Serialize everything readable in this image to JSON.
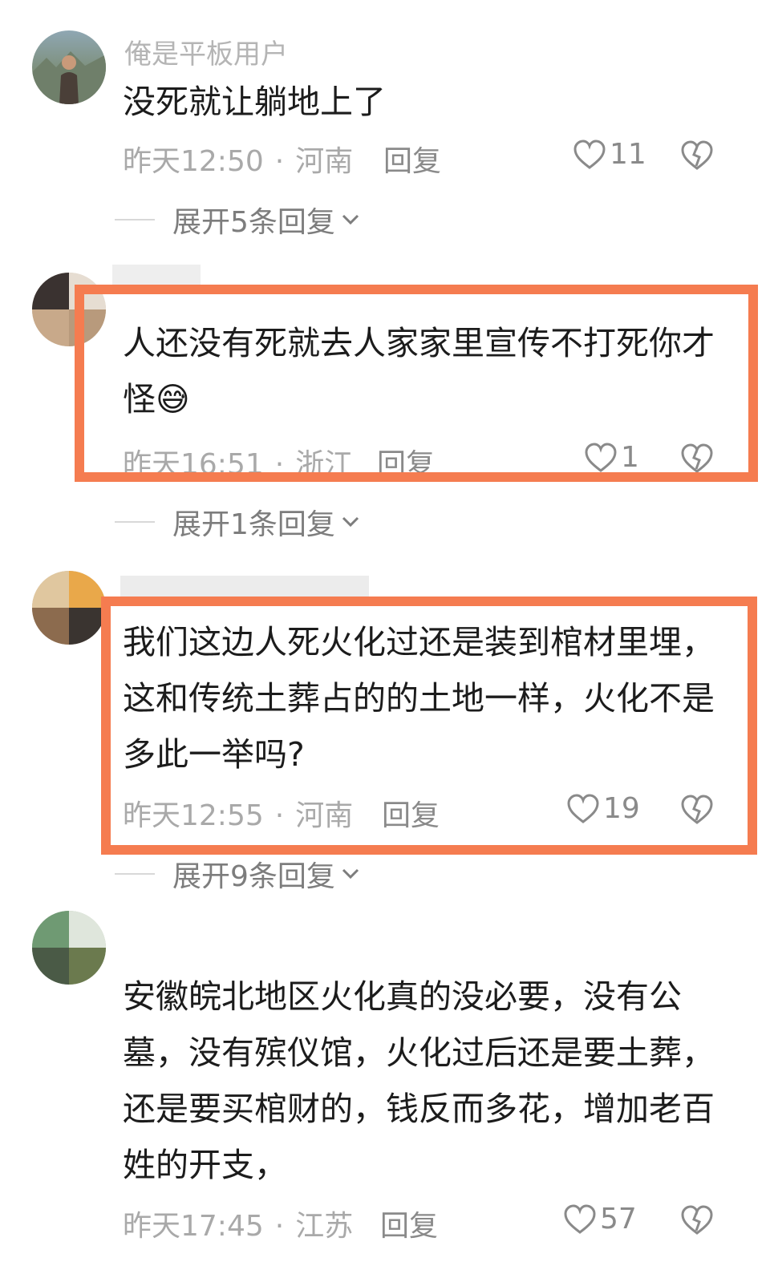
{
  "comments": [
    {
      "username": "俺是平板用户",
      "text": "没死就让躺地上了",
      "time": "昨天12:50",
      "region": "河南",
      "reply_label": "回复",
      "likes": "11",
      "expand_label": "展开5条回复"
    },
    {
      "username": "",
      "text": "人还没有死就去人家家里宣传不打死你才怪😅",
      "time": "昨天16:51",
      "region": "浙江",
      "reply_label": "回复",
      "likes": "1",
      "expand_label": "展开1条回复"
    },
    {
      "username": "",
      "text": "我们这边人死火化过还是装到棺材里埋，这和传统土葬占的的土地一样，火化不是多此一举吗?",
      "time": "昨天12:55",
      "region": "河南",
      "reply_label": "回复",
      "likes": "19",
      "expand_label": "展开9条回复"
    },
    {
      "username": "",
      "text": "安徽皖北地区火化真的没必要，没有公墓，没有殡仪馆，火化过后还是要土葬，还是要买棺财的，钱反而多花，增加老百姓的开支，",
      "time": "昨天17:45",
      "region": "江苏",
      "reply_label": "回复",
      "likes": "57"
    }
  ],
  "separator": "·",
  "colors": {
    "highlight": "#f57c50",
    "text": "#1c1c1c",
    "meta": "#a9a9a9"
  },
  "icons": [
    "heart-outline-icon",
    "broken-heart-icon",
    "chevron-down-icon"
  ]
}
